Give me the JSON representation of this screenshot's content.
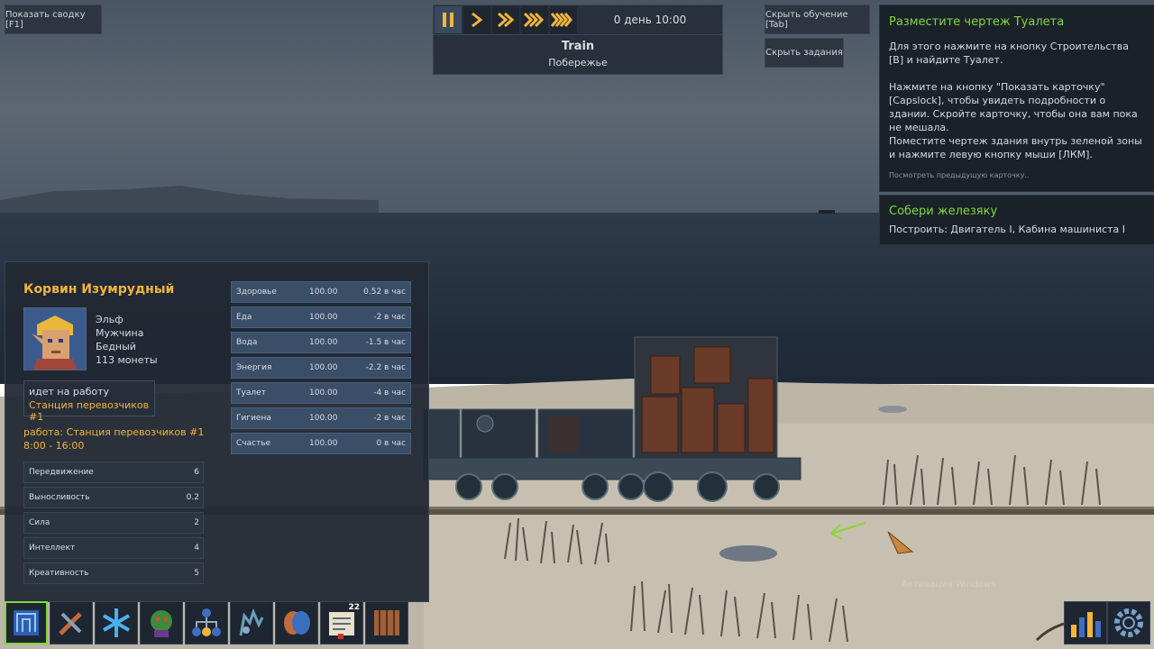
{
  "top_left": {
    "summary_button": "Показать сводку [F1]"
  },
  "speed": {
    "buttons": [
      "pause",
      "play",
      "fast",
      "faster",
      "fastest"
    ],
    "clock": "0 день 10:00"
  },
  "location": {
    "title": "Train",
    "subtitle": "Побережье"
  },
  "top_right": {
    "hide_tutorial": "Скрыть обучение [Tab]",
    "hide_tasks": "Скрыть задания"
  },
  "tutorial": {
    "title": "Разместите чертеж Туалета",
    "p1": "Для этого нажмите на кнопку Строительства [B] и найдите Туалет.",
    "p2": "Нажмите на кнопку \"Показать карточку\" [Capslock], чтобы увидеть подробности о здании. Скройте карточку, чтобы она вам пока не мешала.",
    "p3": "Поместите чертеж здания внутрь зеленой зоны и нажмите левую кнопку мыши [ЛКМ].",
    "prev": "Посмотреть предыдущую карточку.."
  },
  "task": {
    "title": "Собери железяку",
    "text": "Построить: Двигатель I, Кабина машиниста I"
  },
  "character": {
    "name": "Корвин Изумрудный",
    "race": "Эльф",
    "gender": "Мужчина",
    "wealth": "Бедный",
    "coins": "113 монеты",
    "activity": "идет на работу",
    "activity_place": "Станция перевозчиков #1",
    "work": "работа: Станция перевозчиков #1",
    "hours": "8:00 - 16:00",
    "skills": [
      {
        "label": "Передвижение",
        "value": "6"
      },
      {
        "label": "Выносливость",
        "value": "0.2"
      },
      {
        "label": "Сила",
        "value": "2"
      },
      {
        "label": "Интеллект",
        "value": "4"
      },
      {
        "label": "Креативность",
        "value": "5"
      }
    ],
    "needs": [
      {
        "label": "Здоровье",
        "value": "100.00",
        "rate": "0.52 в час"
      },
      {
        "label": "Еда",
        "value": "100.00",
        "rate": "-2 в час"
      },
      {
        "label": "Вода",
        "value": "100.00",
        "rate": "-1.5 в час"
      },
      {
        "label": "Энергия",
        "value": "100.00",
        "rate": "-2.2 в час"
      },
      {
        "label": "Туалет",
        "value": "100.00",
        "rate": "-4 в час"
      },
      {
        "label": "Гигиена",
        "value": "100.00",
        "rate": "-2 в час"
      },
      {
        "label": "Счастье",
        "value": "100.00",
        "rate": "0 в час"
      }
    ]
  },
  "toolbar": {
    "items": [
      "blueprint-icon",
      "tools-icon",
      "snowflake-icon",
      "goblin-icon",
      "hierarchy-icon",
      "creatures-icon",
      "masks-icon",
      "notes-icon",
      "map-icon"
    ],
    "notes_badge": "22"
  },
  "watermark": {
    "line1": "Активация Windows"
  },
  "colors": {
    "accent_gold": "#f2b53a",
    "accent_green": "#7fd93a"
  }
}
